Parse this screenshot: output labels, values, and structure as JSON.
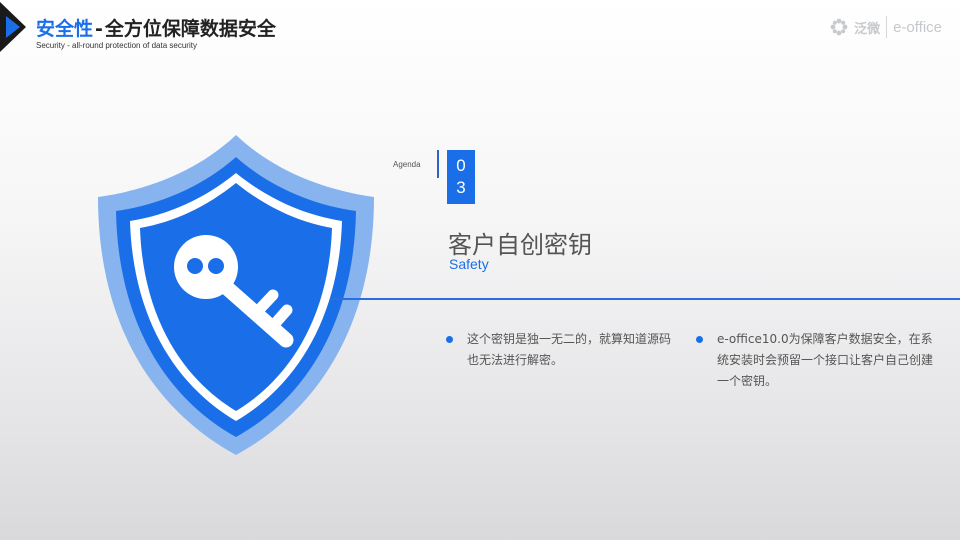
{
  "header": {
    "title_accent": "安全性",
    "title_dash": "-",
    "title_main": "全方位保障数据安全",
    "subtitle": "Security - all-round protection of data security",
    "logo_cn": "泛微",
    "logo_en": "e-office"
  },
  "agenda": {
    "label": "Agenda",
    "number_digit_1": "0",
    "number_digit_2": "3"
  },
  "section": {
    "title": "客户自创密钥",
    "subtitle": "Safety"
  },
  "bullets": [
    {
      "text": "这个密钥是独一无二的，就算知道源码也无法进行解密。"
    },
    {
      "text": "e-office10.0为保障客户数据安全，在系统安装时会预留一个接口让客户自己创建一个密钥。"
    }
  ],
  "colors": {
    "accent": "#1a6fe8",
    "shield_outer": "#87b3ef",
    "shield_inner": "#1a6fe8"
  },
  "icons": {
    "shield": "shield-key-icon",
    "key": "key-icon",
    "logo": "flower-logo-icon"
  }
}
